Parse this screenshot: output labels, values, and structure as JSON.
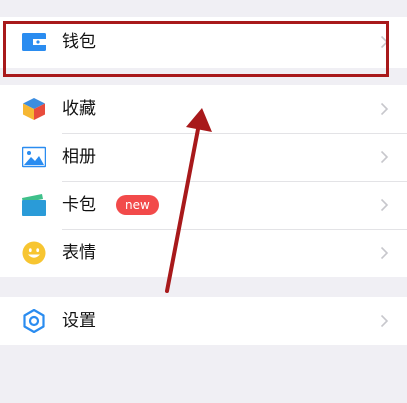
{
  "menu": {
    "wallet": {
      "label": "钱包",
      "icon": "wallet-icon"
    },
    "favorites": {
      "label": "收藏",
      "icon": "cube-icon"
    },
    "album": {
      "label": "相册",
      "icon": "picture-icon"
    },
    "cards": {
      "label": "卡包",
      "icon": "card-icon",
      "badge": "new"
    },
    "stickers": {
      "label": "表情",
      "icon": "smiley-icon"
    },
    "settings": {
      "label": "设置",
      "icon": "gear-icon"
    }
  },
  "colors": {
    "annotation": "#a8191b",
    "badge": "#f24a4a",
    "wallet": "#2a8cf0",
    "background": "#f0eff4"
  }
}
